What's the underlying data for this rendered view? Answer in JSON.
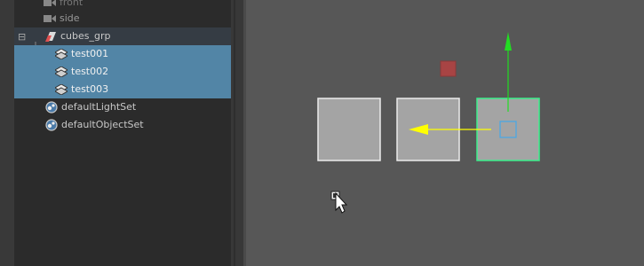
{
  "outliner": {
    "items": [
      {
        "label": "front",
        "icon": "camera-icon"
      },
      {
        "label": "side",
        "icon": "camera-icon"
      },
      {
        "label": "cubes_grp",
        "icon": "group-icon",
        "expander": "⊟"
      },
      {
        "label": "test001",
        "icon": "mesh-icon"
      },
      {
        "label": "test002",
        "icon": "mesh-icon"
      },
      {
        "label": "test003",
        "icon": "mesh-icon"
      },
      {
        "label": "defaultLightSet",
        "icon": "set-icon"
      },
      {
        "label": "defaultObjectSet",
        "icon": "set-icon"
      }
    ]
  },
  "colors": {
    "selection": "#5285a6",
    "manipulator_y": "#22dd22",
    "manipulator_x_active": "#ffff00",
    "selected_wire": "#3cf08c",
    "pivot_box": "#a84444"
  }
}
